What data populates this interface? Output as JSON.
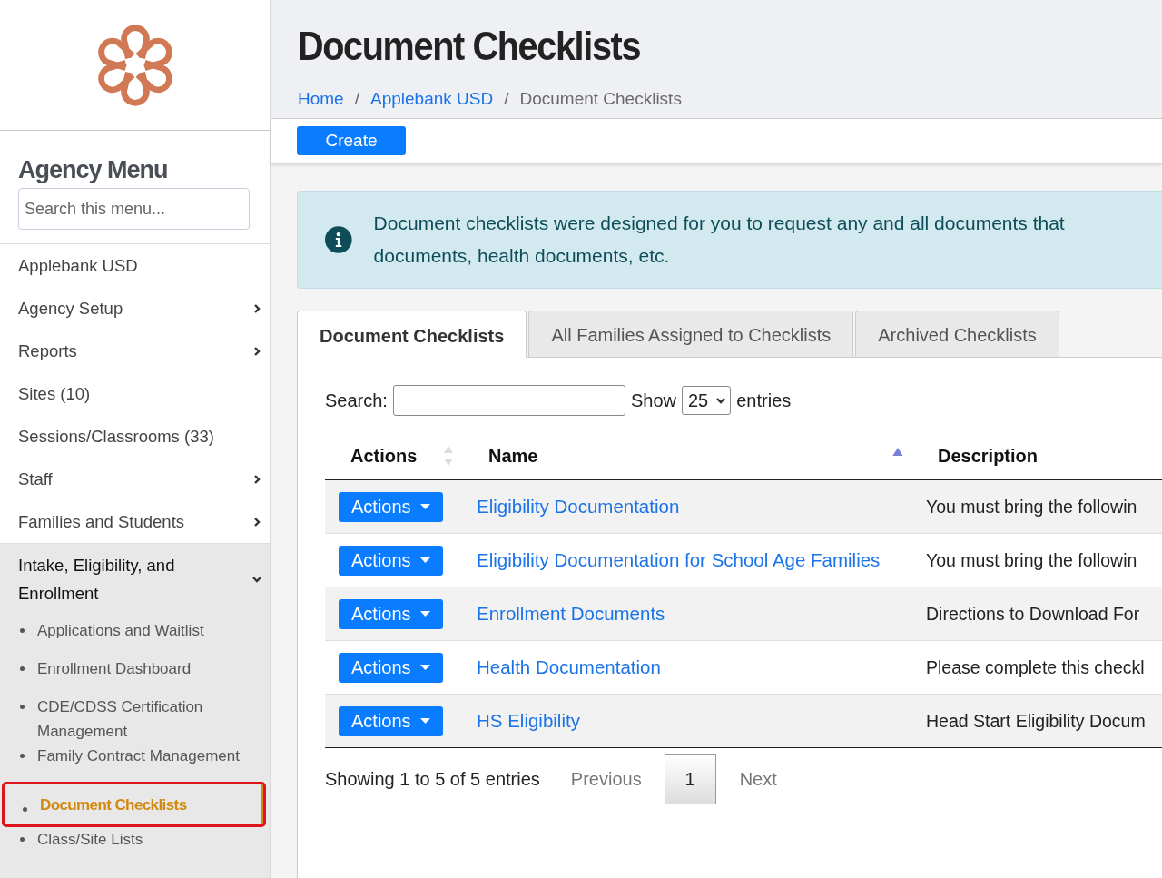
{
  "sidebar": {
    "heading": "Agency Menu",
    "search": {
      "placeholder": "Search this menu..."
    },
    "items": [
      {
        "label": "Applebank USD",
        "kind": "link"
      },
      {
        "label": "Agency Setup",
        "kind": "submenu",
        "expanded": false
      },
      {
        "label": "Reports",
        "kind": "submenu",
        "expanded": false
      },
      {
        "label": "Sites (10)",
        "kind": "link"
      },
      {
        "label": "Sessions/Classrooms (33)",
        "kind": "link"
      },
      {
        "label": "Staff",
        "kind": "submenu",
        "expanded": false
      },
      {
        "label": "Families and Students",
        "kind": "submenu",
        "expanded": false
      },
      {
        "label": "Intake, Eligibility, and Enrollment",
        "kind": "submenu",
        "expanded": true,
        "children": [
          {
            "label": "Applications and Waitlist",
            "selected": false
          },
          {
            "label": "Enrollment Dashboard",
            "selected": false
          },
          {
            "label": "CDE/CDSS Certification Management",
            "selected": false
          },
          {
            "label": "Family Contract Management",
            "selected": false
          },
          {
            "label": "Document Checklists",
            "selected": true
          },
          {
            "label": "Class/Site Lists",
            "selected": false
          }
        ]
      }
    ]
  },
  "page": {
    "title": "Document Checklists",
    "breadcrumbs": [
      {
        "label": "Home",
        "link": true
      },
      {
        "label": "Applebank USD",
        "link": true
      },
      {
        "label": "Document Checklists",
        "link": false
      }
    ],
    "separator": "/"
  },
  "toolbar": {
    "create_button": "Create"
  },
  "info_alert": "Document checklists were designed for you to request any and all documents that documents, health documents, etc.",
  "tabs": [
    {
      "label": "Document Checklists",
      "selected": true
    },
    {
      "label": "All Families Assigned to Checklists",
      "selected": false
    },
    {
      "label": "Archived Checklists",
      "selected": false
    }
  ],
  "table_controls": {
    "search_label": "Search:",
    "show_label": "Show",
    "page_size": "25",
    "entries_label": "entries"
  },
  "table": {
    "columns": [
      {
        "label": "Actions",
        "kind": "sortable"
      },
      {
        "label": "Name",
        "kind": "sorted-ascending"
      },
      {
        "label": "Description",
        "kind": "plain"
      }
    ],
    "rows": [
      {
        "action": "Actions",
        "name": "Eligibility Documentation",
        "description": "You must bring the followin"
      },
      {
        "action": "Actions",
        "name": "Eligibility Documentation for School Age Families",
        "description": "You must bring the followin"
      },
      {
        "action": "Actions",
        "name": "Enrollment Documents",
        "description": "Directions to Download For"
      },
      {
        "action": "Actions",
        "name": "Health Documentation",
        "description": "Please complete this checkl"
      },
      {
        "action": "Actions",
        "name": "HS Eligibility",
        "description": "Head Start Eligibility Docum"
      }
    ]
  },
  "pagination": {
    "info": "Showing 1 to 5 of 5 entries",
    "previous": "Previous",
    "pages": [
      {
        "label": "1",
        "selected": true
      }
    ],
    "next": "Next"
  }
}
